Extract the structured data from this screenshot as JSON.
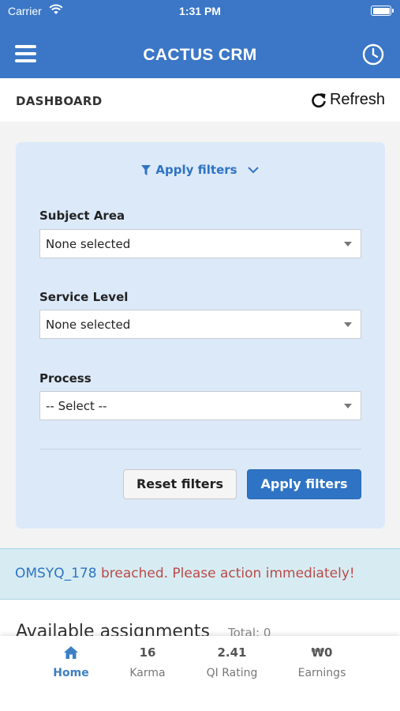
{
  "status_bar": {
    "carrier": "Carrier",
    "time": "1:31 PM"
  },
  "header": {
    "title": "CACTUS CRM",
    "menu_icon": "menu-icon",
    "history_icon": "clock-icon"
  },
  "subheader": {
    "title": "DASHBOARD",
    "refresh_label": "Refresh"
  },
  "filters": {
    "toggle_label": "Apply filters",
    "fields": [
      {
        "label": "Subject Area",
        "value": "None selected"
      },
      {
        "label": "Service Level",
        "value": "None selected"
      },
      {
        "label": "Process",
        "value": "-- Select --"
      }
    ],
    "reset_label": "Reset filters",
    "apply_label": "Apply filters"
  },
  "alert": {
    "link": "OMSYQ_178",
    "message": " breached. Please action immediately!"
  },
  "assignments": {
    "title": "Available assignments",
    "total": "Total: 0"
  },
  "tabs": [
    {
      "value": "",
      "label": "Home",
      "icon": "home-icon",
      "active": true
    },
    {
      "value": "16",
      "label": "Karma"
    },
    {
      "value": "2.41",
      "label": "QI Rating"
    },
    {
      "value": "₩0",
      "label": "Earnings"
    }
  ],
  "colors": {
    "primary": "#3b77c6",
    "accent": "#2f74c4",
    "alert_bg": "#d7ecf2",
    "danger": "#b94a48"
  }
}
